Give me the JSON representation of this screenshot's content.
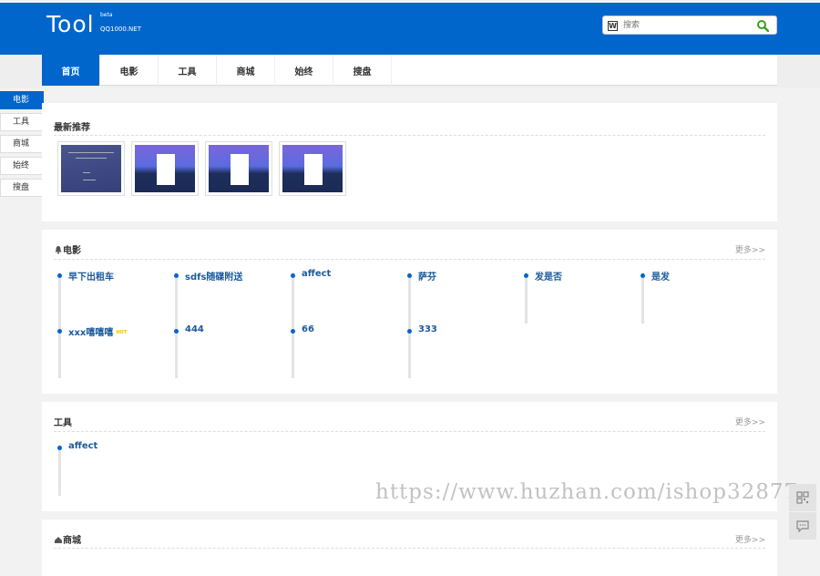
{
  "header": {
    "logo": "Tool",
    "beta": "beta",
    "domain": "QQ1000.NET",
    "search_icon": "w-icon",
    "search_placeholder": "搜索"
  },
  "nav": {
    "items": [
      "首页",
      "电影",
      "工具",
      "商城",
      "始终",
      "搜盘"
    ],
    "active": 0
  },
  "sidebar": {
    "items": [
      "电影",
      "工具",
      "商城",
      "始终",
      "搜盘"
    ],
    "active": 0
  },
  "sections": {
    "latest": {
      "title": "最新推荐"
    },
    "movies": {
      "title": "电影",
      "more": "更多>>",
      "items": [
        "早下出租车",
        "sdfs随碟附送",
        "affect",
        "萨芬",
        "发是否",
        "是发",
        "xxx嘻嘻嘻",
        "444",
        "66",
        "333"
      ],
      "hot_badge": "HOT"
    },
    "tools": {
      "title": "工具",
      "more": "更多>>",
      "items": [
        "affect"
      ]
    },
    "mall": {
      "title": "商城",
      "more": "更多>>"
    }
  },
  "watermark": "https://www.huzhan.com/ishop32877",
  "colors": {
    "brand": "#0066cc",
    "link": "#1a5a9c",
    "hot": "#f0c000"
  }
}
